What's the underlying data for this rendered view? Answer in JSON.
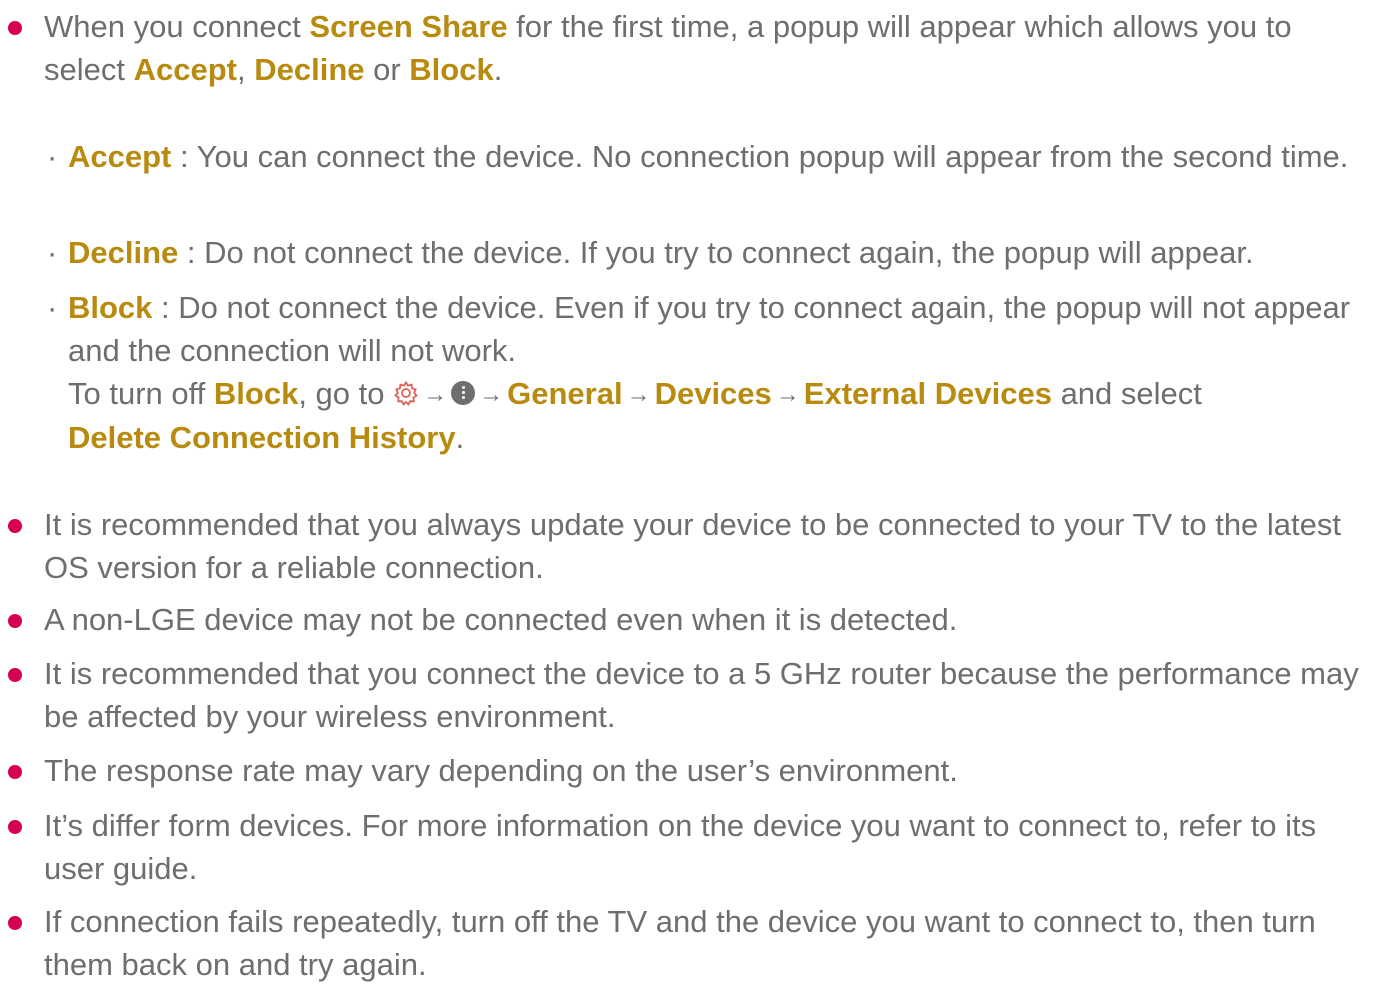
{
  "intro": {
    "text_before": "When you connect ",
    "kw_screen_share": "Screen Share",
    "text_after_kw": " for the first time, a popup will appear which allows you to select ",
    "kw_accept": "Accept",
    "comma": ", ",
    "kw_decline": "Decline",
    "or": " or ",
    "kw_block": "Block",
    "period": "."
  },
  "options": {
    "accept": {
      "mark": "·",
      "label": "Accept",
      "text": " : You can connect the device. No connection popup will appear from the second time."
    },
    "decline": {
      "mark": "·",
      "label": "Decline",
      "text": " : Do not connect the device. If you try to connect again, the popup will appear."
    },
    "block": {
      "mark": "·",
      "label": "Block",
      "text": " : Do not connect the device. Even if you try to connect again, the popup will not appear and the connection will not work.",
      "turnoff_prefix": "To turn off ",
      "turnoff_kw": "Block",
      "turnoff_goto": ", go to ",
      "arrow": "→",
      "path_general": "General",
      "path_devices": "Devices",
      "path_external": "External Devices",
      "and_select": " and select ",
      "delete_history": "Delete Connection History",
      "end": "."
    }
  },
  "icons": {
    "settings": "gear-icon",
    "more": "more-dots-icon",
    "bullet_color": "#d6004f",
    "keyword_color": "#b88a0e"
  },
  "notes": [
    "It is recommended that you always update your device to be connected to your TV to the latest OS version for a reliable connection.",
    "A non-LGE device may not be connected even when it is detected.",
    "It is recommended that you connect the device to a 5 GHz router because the performance may be affected by your wireless environment.",
    "The response rate may vary depending on the user’s environment.",
    "It’s differ form devices. For more information on the device you want to connect to, refer to its user guide.",
    "If connection fails repeatedly, turn off the TV and the device you want to connect to, then turn them back on and try again."
  ]
}
